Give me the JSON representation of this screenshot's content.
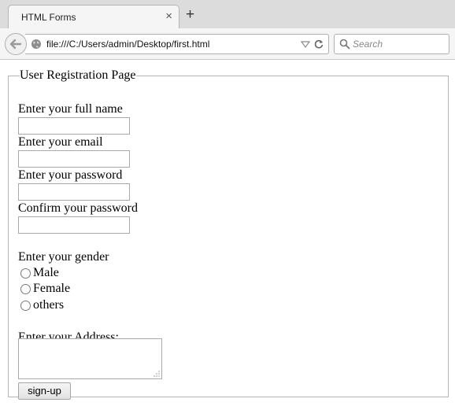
{
  "browser": {
    "tab_title": "HTML Forms",
    "close_glyph": "×",
    "new_tab_glyph": "+",
    "url": "file:///C:/Users/admin/Desktop/first.html",
    "search_placeholder": "Search"
  },
  "form": {
    "legend": "User Registration Page",
    "full_name_label": "Enter your full name",
    "email_label": "Enter your email",
    "password_label": "Enter your password",
    "confirm_password_label": "Confirm your password",
    "gender_label": "Enter your gender",
    "gender_options": [
      "Male",
      "Female",
      "others"
    ],
    "address_label": "Enter your Address:",
    "submit_label": "sign-up"
  }
}
